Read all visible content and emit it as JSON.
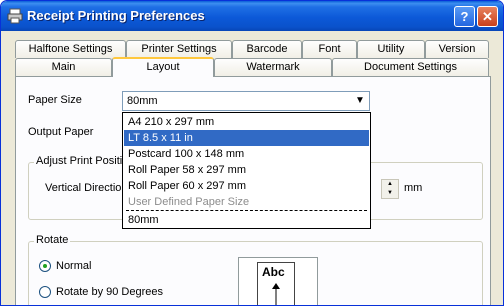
{
  "window": {
    "title": "Receipt Printing Preferences",
    "help_label": "?",
    "close_label": "✕"
  },
  "tabs_back": [
    "Halftone Settings",
    "Printer Settings",
    "Barcode",
    "Font",
    "Utility",
    "Version"
  ],
  "tabs_front": [
    "Main",
    "Layout",
    "Watermark",
    "Document Settings"
  ],
  "active_tab": "Layout",
  "paper_size": {
    "label": "Paper Size",
    "value": "80mm"
  },
  "output_paper": {
    "label": "Output Paper"
  },
  "adjust_group": {
    "title": "Adjust Print Position",
    "vertical_label": "Vertical Direction",
    "unit": "mm"
  },
  "dropdown": {
    "options": [
      {
        "label": "A4 210 x 297 mm",
        "state": "normal"
      },
      {
        "label": "LT 8.5 x 11 in",
        "state": "selected"
      },
      {
        "label": "Postcard 100 x 148 mm",
        "state": "normal"
      },
      {
        "label": "Roll Paper 58 x 297 mm",
        "state": "normal"
      },
      {
        "label": "Roll Paper 60 x 297 mm",
        "state": "normal"
      },
      {
        "label": "User Defined Paper Size",
        "state": "disabled"
      },
      {
        "label": "80mm",
        "state": "normal"
      }
    ]
  },
  "rotate": {
    "title": "Rotate",
    "options": [
      {
        "label": "Normal",
        "checked": true
      },
      {
        "label": "Rotate by 90 Degrees",
        "checked": false
      }
    ]
  },
  "preview": {
    "text": "Abc"
  },
  "colors": {
    "title_bar": "#0a52cc",
    "selection": "#316ac5",
    "active_tab_accent": "#ffc83c"
  }
}
